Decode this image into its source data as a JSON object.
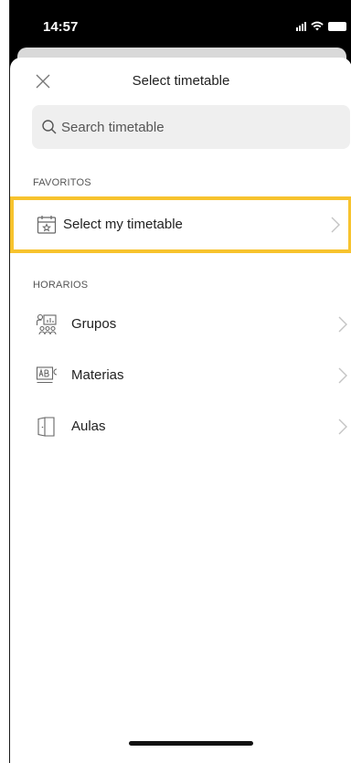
{
  "status_bar": {
    "time": "14:57"
  },
  "header": {
    "title": "Select timetable",
    "close_icon": "close-icon"
  },
  "search": {
    "placeholder": "Search timetable",
    "value": "",
    "icon": "search-icon"
  },
  "favorites": {
    "section_label": "FAVORITOS",
    "items": [
      {
        "label": "Select my timetable",
        "icon": "calendar-star-icon"
      }
    ]
  },
  "horarios": {
    "section_label": "HORARIOS",
    "items": [
      {
        "label": "Grupos",
        "icon": "group-chart-icon"
      },
      {
        "label": "Materias",
        "icon": "subject-abc-icon"
      },
      {
        "label": "Aulas",
        "icon": "door-icon"
      }
    ]
  },
  "colors": {
    "highlight": "#f7c32e",
    "search_bg": "#efefef",
    "text": "#222222"
  }
}
